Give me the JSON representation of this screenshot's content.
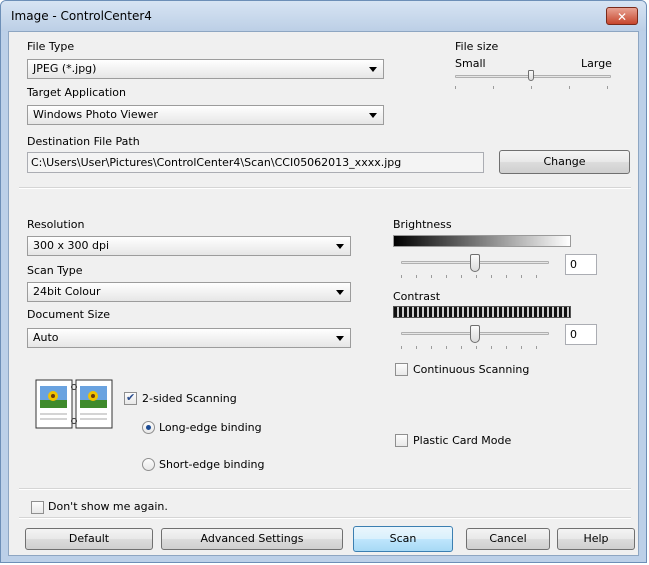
{
  "window": {
    "title": "Image - ControlCenter4",
    "close_glyph": "✕"
  },
  "file_type": {
    "label": "File Type",
    "value": "JPEG (*.jpg)"
  },
  "file_size": {
    "label": "File size",
    "small_label": "Small",
    "large_label": "Large",
    "level_fraction": 0.5
  },
  "target_application": {
    "label": "Target Application",
    "value": "Windows Photo Viewer"
  },
  "destination": {
    "label": "Destination File Path",
    "value": "C:\\Users\\User\\Pictures\\ControlCenter4\\Scan\\CCI05062013_xxxx.jpg",
    "change_label": "Change"
  },
  "resolution": {
    "label": "Resolution",
    "value": "300 x 300 dpi"
  },
  "scan_type": {
    "label": "Scan Type",
    "value": "24bit Colour"
  },
  "document_size": {
    "label": "Document Size",
    "value": "Auto"
  },
  "brightness": {
    "label": "Brightness",
    "value": "0"
  },
  "contrast": {
    "label": "Contrast",
    "value": "0"
  },
  "options": {
    "continuous_scanning": "Continuous Scanning",
    "two_sided_scanning": "2-sided Scanning",
    "long_edge_binding": "Long-edge binding",
    "short_edge_binding": "Short-edge binding",
    "plastic_card_mode": "Plastic Card Mode",
    "dont_show_again": "Don't show me again."
  },
  "buttons": {
    "default": "Default",
    "advanced_settings": "Advanced Settings",
    "scan": "Scan",
    "cancel": "Cancel",
    "help": "Help"
  }
}
